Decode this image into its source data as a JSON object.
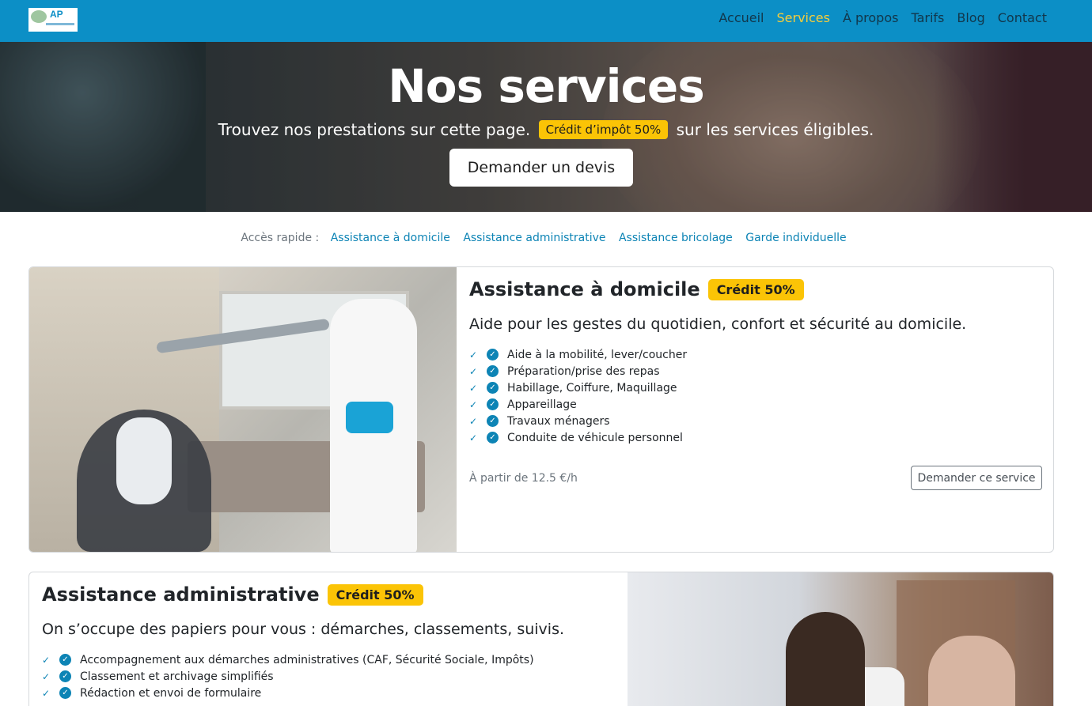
{
  "brand": {
    "logo_text": "AP"
  },
  "nav": {
    "items": [
      {
        "label": "Accueil",
        "active": false
      },
      {
        "label": "Services",
        "active": true
      },
      {
        "label": "À propos",
        "active": false
      },
      {
        "label": "Tarifs",
        "active": false
      },
      {
        "label": "Blog",
        "active": false
      },
      {
        "label": "Contact",
        "active": false
      }
    ]
  },
  "hero": {
    "title": "Nos services",
    "subtitle_before": "Trouvez nos prestations sur cette page.",
    "badge": "Crédit d’impôt 50%",
    "subtitle_after": "sur les services éligibles.",
    "cta": "Demander un devis"
  },
  "quick_access": {
    "label": "Accès rapide :",
    "links": [
      "Assistance à domicile",
      "Assistance administrative",
      "Assistance bricolage",
      "Garde individuelle"
    ]
  },
  "services": [
    {
      "title": "Assistance à domicile",
      "badge": "Crédit 50%",
      "lead": "Aide pour les gestes du quotidien, confort et sécurité au domicile.",
      "features": [
        "Aide à la mobilité, lever/coucher",
        "Préparation/prise des repas",
        "Habillage, Coiffure, Maquillage",
        "Appareillage",
        "Travaux ménagers",
        "Conduite de véhicule personnel"
      ],
      "price": "À partir de 12.5 €/h",
      "button": "Demander ce service"
    },
    {
      "title": "Assistance administrative",
      "badge": "Crédit 50%",
      "lead": "On s’occupe des papiers pour vous : démarches, classements, suivis.",
      "features": [
        "Accompagnement aux démarches administratives (CAF, Sécurité Sociale, Impôts)",
        "Classement et archivage simplifiés",
        "Rédaction et envoi de formulaire"
      ]
    }
  ],
  "colors": {
    "navbar": "#0c8fc6",
    "active_nav": "#f7cd3a",
    "badge": "#fbc406",
    "link": "#0d84b5"
  },
  "icons": {
    "check": "check-icon",
    "check_circle": "check-circle-icon"
  }
}
